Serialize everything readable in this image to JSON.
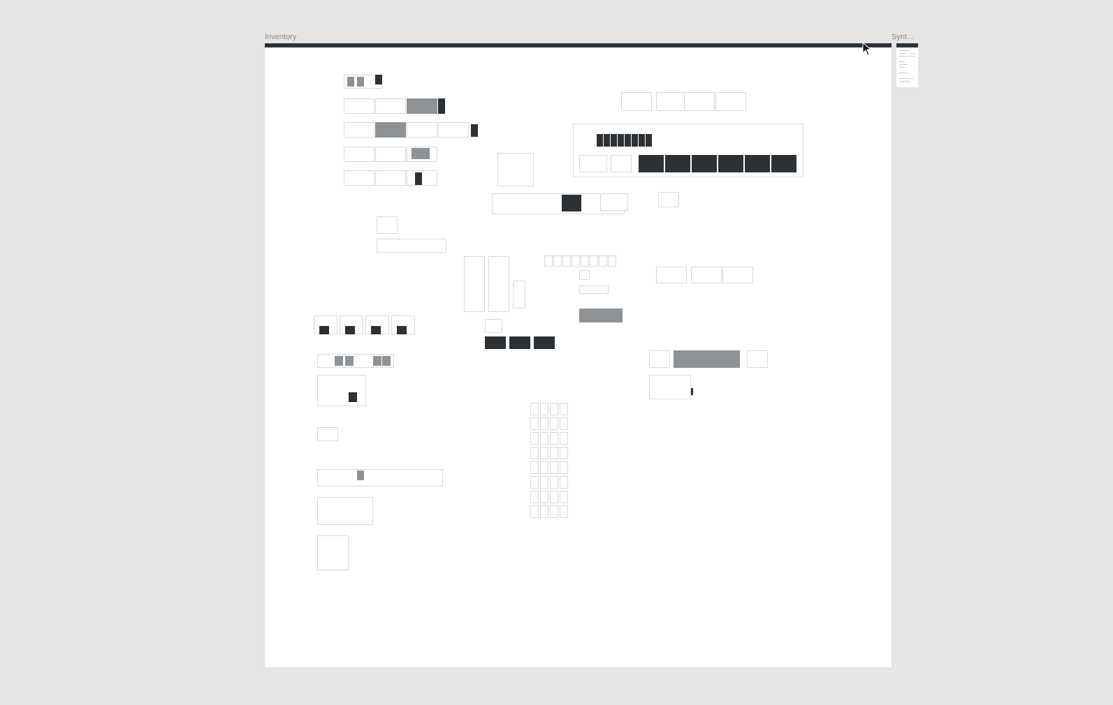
{
  "canvas": {
    "background": "#e5e5e4",
    "frame_bar_color": "#2b3238",
    "frames": [
      {
        "label": "Inventory"
      },
      {
        "label": "Synt..."
      }
    ]
  },
  "cursor": {
    "icon": "mouse-pointer-icon"
  }
}
